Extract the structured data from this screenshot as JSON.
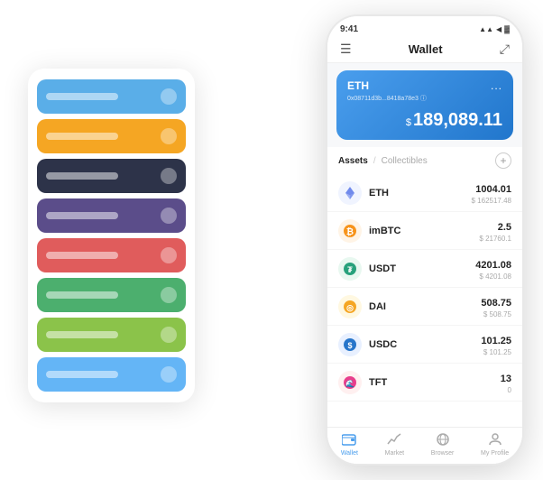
{
  "scene": {
    "card_stack": {
      "items": [
        {
          "color": "card-blue",
          "label": ""
        },
        {
          "color": "card-orange",
          "label": ""
        },
        {
          "color": "card-dark",
          "label": ""
        },
        {
          "color": "card-purple",
          "label": ""
        },
        {
          "color": "card-red",
          "label": ""
        },
        {
          "color": "card-green",
          "label": ""
        },
        {
          "color": "card-light-green",
          "label": ""
        },
        {
          "color": "card-sky",
          "label": ""
        }
      ]
    },
    "phone": {
      "status_bar": {
        "time": "9:41",
        "icons": "▲▲ ◀"
      },
      "header": {
        "menu_icon": "☰",
        "title": "Wallet",
        "expand_icon": "⤢"
      },
      "eth_card": {
        "name": "ETH",
        "address": "0x08711d3b...8418a78e3 ⓘ",
        "more": "...",
        "dollar_sign": "$",
        "balance": "189,089.11"
      },
      "assets": {
        "tab_active": "Assets",
        "separator": "/",
        "tab_inactive": "Collectibles",
        "add_icon": "+"
      },
      "asset_list": [
        {
          "name": "ETH",
          "icon": "◆",
          "icon_class": "asset-icon-eth",
          "amount_primary": "1004.01",
          "amount_secondary": "$ 162517.48"
        },
        {
          "name": "imBTC",
          "icon": "₿",
          "icon_class": "asset-icon-imbtc",
          "amount_primary": "2.5",
          "amount_secondary": "$ 21760.1"
        },
        {
          "name": "USDT",
          "icon": "₮",
          "icon_class": "asset-icon-usdt",
          "amount_primary": "4201.08",
          "amount_secondary": "$ 4201.08"
        },
        {
          "name": "DAI",
          "icon": "◎",
          "icon_class": "asset-icon-dai",
          "amount_primary": "508.75",
          "amount_secondary": "$ 508.75"
        },
        {
          "name": "USDC",
          "icon": "©",
          "icon_class": "asset-icon-usdc",
          "amount_primary": "101.25",
          "amount_secondary": "$ 101.25"
        },
        {
          "name": "TFT",
          "icon": "🌊",
          "icon_class": "asset-icon-tft",
          "amount_primary": "13",
          "amount_secondary": "0"
        }
      ],
      "nav": [
        {
          "icon": "👛",
          "label": "Wallet",
          "active": true
        },
        {
          "icon": "📈",
          "label": "Market",
          "active": false
        },
        {
          "icon": "🌐",
          "label": "Browser",
          "active": false
        },
        {
          "icon": "👤",
          "label": "My Profile",
          "active": false
        }
      ]
    }
  }
}
